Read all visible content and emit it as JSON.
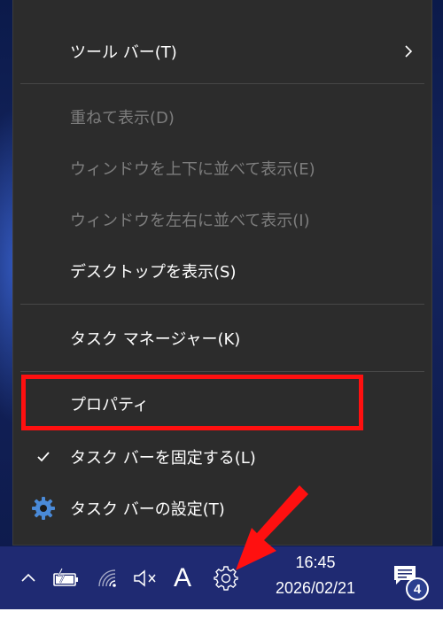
{
  "context_menu": {
    "items": [
      {
        "label": "ツール バー(T)",
        "enabled": true,
        "submenu": true,
        "icon": "chevron-right-icon"
      },
      {
        "label": "重ねて表示(D)",
        "enabled": false
      },
      {
        "label": "ウィンドウを上下に並べて表示(E)",
        "enabled": false
      },
      {
        "label": "ウィンドウを左右に並べて表示(I)",
        "enabled": false
      },
      {
        "label": "デスクトップを表示(S)",
        "enabled": true
      },
      {
        "label": "タスク マネージャー(K)",
        "enabled": true
      },
      {
        "label": "プロパティ",
        "enabled": true,
        "highlighted": true
      },
      {
        "label": "タスク バーを固定する(L)",
        "enabled": true,
        "checked": true,
        "icon": "checkmark-icon"
      },
      {
        "label": "タスク バーの設定(T)",
        "enabled": true,
        "icon": "settings-gear-icon"
      }
    ]
  },
  "taskbar": {
    "tray_icons": [
      "chevron-up-icon",
      "battery-charging-icon",
      "wifi-icon",
      "volume-muted-icon",
      "ime-mode-icon",
      "gear-icon"
    ],
    "ime_label": "A",
    "clock_time": "16:45",
    "clock_date": "2026/02/21",
    "notification_count": "4"
  },
  "colors": {
    "menu_bg": "#2c2c2c",
    "disabled_text": "#7d7d7d",
    "taskbar_bg": "#1f2a72",
    "highlight_red": "#ff1010",
    "settings_icon_blue": "#4a8ad8"
  }
}
